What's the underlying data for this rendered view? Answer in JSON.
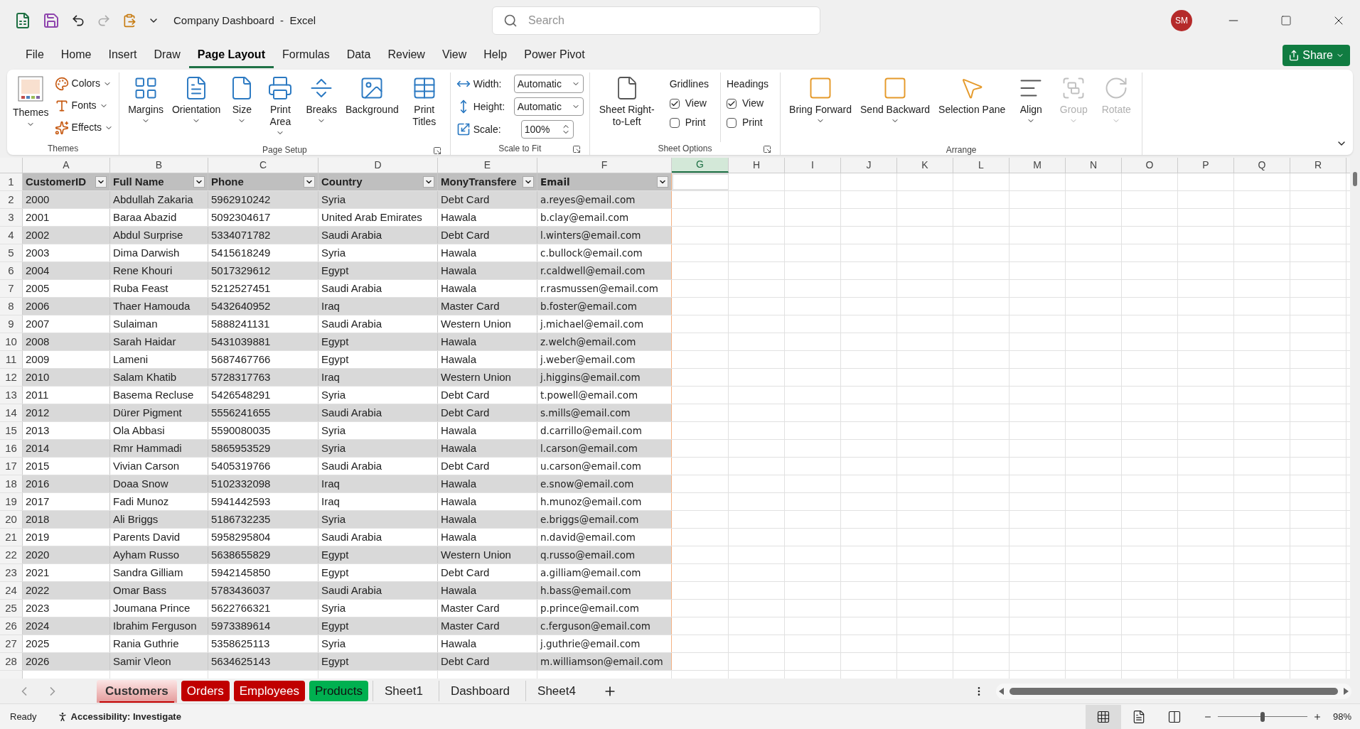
{
  "window": {
    "title": "Company Dashboard  -  Excel",
    "search": {
      "placeholder": "Search"
    },
    "avatar": "SM"
  },
  "menu_tabs": [
    {
      "label": "File",
      "selected": false
    },
    {
      "label": "Home",
      "selected": false
    },
    {
      "label": "Insert",
      "selected": false
    },
    {
      "label": "Draw",
      "selected": false
    },
    {
      "label": "Page Layout",
      "selected": true
    },
    {
      "label": "Formulas",
      "selected": false
    },
    {
      "label": "Data",
      "selected": false
    },
    {
      "label": "Review",
      "selected": false
    },
    {
      "label": "View",
      "selected": false
    },
    {
      "label": "Help",
      "selected": false
    },
    {
      "label": "Power Pivot",
      "selected": false
    }
  ],
  "share_button": "Share",
  "ribbon": {
    "themes": {
      "title": "Themes",
      "big": {
        "label": "Themes",
        "dropdown": true
      },
      "small": [
        {
          "label": "Colors",
          "dropdown": true
        },
        {
          "label": "Fonts",
          "dropdown": true
        },
        {
          "label": "Effects",
          "dropdown": true
        }
      ]
    },
    "page_setup": {
      "title": "Page Setup",
      "launcher": true,
      "buttons": [
        {
          "label": "Margins",
          "dropdown": true
        },
        {
          "label": "Orientation",
          "dropdown": true
        },
        {
          "label": "Size",
          "dropdown": true
        },
        {
          "label": "Print Area",
          "dropdown": true
        },
        {
          "label": "Breaks",
          "dropdown": true
        },
        {
          "label": "Background",
          "dropdown": false
        },
        {
          "label": "Print Titles",
          "dropdown": false
        }
      ]
    },
    "scale_to_fit": {
      "title": "Scale to Fit",
      "launcher": true,
      "fields": [
        {
          "label": "Width:",
          "value": "Automatic",
          "kind": "select"
        },
        {
          "label": "Height:",
          "value": "Automatic",
          "kind": "select"
        },
        {
          "label": "Scale:",
          "value": "100%",
          "kind": "spin"
        }
      ]
    },
    "sheet_options": {
      "title": "Sheet Options",
      "launcher": true,
      "button": {
        "label": "Sheet Right-to-Left"
      },
      "columns": [
        {
          "heading": "Gridlines",
          "options": [
            {
              "label": "View",
              "checked": true
            },
            {
              "label": "Print",
              "checked": false
            }
          ]
        },
        {
          "heading": "Headings",
          "options": [
            {
              "label": "View",
              "checked": true
            },
            {
              "label": "Print",
              "checked": false
            }
          ]
        }
      ]
    },
    "arrange": {
      "title": "Arrange",
      "buttons": [
        {
          "label": "Bring Forward",
          "dropdown": true,
          "disabled": false
        },
        {
          "label": "Send Backward",
          "dropdown": true,
          "disabled": false
        },
        {
          "label": "Selection Pane",
          "dropdown": false,
          "disabled": false
        },
        {
          "label": "Align",
          "dropdown": true,
          "disabled": false
        },
        {
          "label": "Group",
          "dropdown": true,
          "disabled": true
        },
        {
          "label": "Rotate",
          "dropdown": true,
          "disabled": true
        }
      ]
    }
  },
  "sheet": {
    "columns": [
      {
        "label": "A",
        "selected": false
      },
      {
        "label": "B",
        "selected": false
      },
      {
        "label": "C",
        "selected": false
      },
      {
        "label": "D",
        "selected": false
      },
      {
        "label": "E",
        "selected": false
      },
      {
        "label": "F",
        "selected": false
      },
      {
        "label": "G",
        "selected": true
      },
      {
        "label": "H",
        "selected": false
      },
      {
        "label": "I",
        "selected": false
      },
      {
        "label": "J",
        "selected": false
      },
      {
        "label": "K",
        "selected": false
      },
      {
        "label": "L",
        "selected": false
      },
      {
        "label": "M",
        "selected": false
      },
      {
        "label": "N",
        "selected": false
      },
      {
        "label": "O",
        "selected": false
      },
      {
        "label": "P",
        "selected": false
      },
      {
        "label": "Q",
        "selected": false
      },
      {
        "label": "R",
        "selected": false
      }
    ],
    "header": {
      "num": "1",
      "cells": [
        "CustomerID",
        "Full Name",
        "Phone",
        "Country",
        "MonyTransfere",
        "Email"
      ]
    },
    "rows": [
      {
        "num": "2",
        "cells": [
          "2000",
          "Abdullah Zakaria",
          "5962910242",
          "Syria",
          "Debt Card",
          "a.reyes@email.com"
        ]
      },
      {
        "num": "3",
        "cells": [
          "2001",
          "Baraa Abazid",
          "5092304617",
          "United Arab Emirates",
          "Hawala",
          "b.clay@email.com"
        ]
      },
      {
        "num": "4",
        "cells": [
          "2002",
          "Abdul Surprise",
          "5334071782",
          "Saudi Arabia",
          "Debt Card",
          "l.winters@email.com"
        ]
      },
      {
        "num": "5",
        "cells": [
          "2003",
          "Dima Darwish",
          "5415618249",
          "Syria",
          "Hawala",
          "c.bullock@email.com"
        ]
      },
      {
        "num": "6",
        "cells": [
          "2004",
          "Rene Khouri",
          "5017329612",
          "Egypt",
          "Hawala",
          "r.caldwell@email.com"
        ]
      },
      {
        "num": "7",
        "cells": [
          "2005",
          "Ruba Feast",
          "5212527451",
          "Saudi Arabia",
          "Hawala",
          "r.rasmussen@email.com"
        ]
      },
      {
        "num": "8",
        "cells": [
          "2006",
          "Thaer Hamouda",
          "5432640952",
          "Iraq",
          "Master Card",
          "b.foster@email.com"
        ]
      },
      {
        "num": "9",
        "cells": [
          "2007",
          "Sulaiman",
          "5888241131",
          "Saudi Arabia",
          "Western Union",
          "j.michael@email.com"
        ]
      },
      {
        "num": "10",
        "cells": [
          "2008",
          "Sarah Haidar",
          "5431039881",
          "Egypt",
          "Hawala",
          "z.welch@email.com"
        ]
      },
      {
        "num": "11",
        "cells": [
          "2009",
          "Lameni",
          "5687467766",
          "Egypt",
          "Hawala",
          "j.weber@email.com"
        ]
      },
      {
        "num": "12",
        "cells": [
          "2010",
          "Salam Khatib",
          "5728317763",
          "Iraq",
          "Western Union",
          "j.higgins@email.com"
        ]
      },
      {
        "num": "13",
        "cells": [
          "2011",
          "Basema Recluse",
          "5426548291",
          "Syria",
          "Debt Card",
          "t.powell@email.com"
        ]
      },
      {
        "num": "14",
        "cells": [
          "2012",
          "Dürer Pigment",
          "5556241655",
          "Saudi Arabia",
          "Debt Card",
          "s.mills@email.com"
        ]
      },
      {
        "num": "15",
        "cells": [
          "2013",
          "Ola Abbasi",
          "5590080035",
          "Syria",
          "Hawala",
          "d.carrillo@email.com"
        ]
      },
      {
        "num": "16",
        "cells": [
          "2014",
          "Rmr Hammadi",
          "5865953529",
          "Syria",
          "Hawala",
          "l.carson@email.com"
        ]
      },
      {
        "num": "17",
        "cells": [
          "2015",
          "Vivian Carson",
          "5405319766",
          "Saudi Arabia",
          "Debt Card",
          "u.carson@email.com"
        ]
      },
      {
        "num": "18",
        "cells": [
          "2016",
          "Doaa Snow",
          "5102332098",
          "Iraq",
          "Hawala",
          "e.snow@email.com"
        ]
      },
      {
        "num": "19",
        "cells": [
          "2017",
          "Fadi Munoz",
          "5941442593",
          "Iraq",
          "Hawala",
          "h.munoz@email.com"
        ]
      },
      {
        "num": "20",
        "cells": [
          "2018",
          "Ali Briggs",
          "5186732235",
          "Syria",
          "Hawala",
          "e.briggs@email.com"
        ]
      },
      {
        "num": "21",
        "cells": [
          "2019",
          "Parents David",
          "5958295804",
          "Saudi Arabia",
          "Hawala",
          "n.david@email.com"
        ]
      },
      {
        "num": "22",
        "cells": [
          "2020",
          "Ayham Russo",
          "5638655829",
          "Egypt",
          "Western Union",
          "q.russo@email.com"
        ]
      },
      {
        "num": "23",
        "cells": [
          "2021",
          "Sandra Gilliam",
          "5942145850",
          "Egypt",
          "Debt Card",
          "a.gilliam@email.com"
        ]
      },
      {
        "num": "24",
        "cells": [
          "2022",
          "Omar Bass",
          "5783436037",
          "Saudi Arabia",
          "Hawala",
          "h.bass@email.com"
        ]
      },
      {
        "num": "25",
        "cells": [
          "2023",
          "Joumana Prince",
          "5622766321",
          "Syria",
          "Master Card",
          "p.prince@email.com"
        ]
      },
      {
        "num": "26",
        "cells": [
          "2024",
          "Ibrahim Ferguson",
          "5973389614",
          "Egypt",
          "Master Card",
          "c.ferguson@email.com"
        ]
      },
      {
        "num": "27",
        "cells": [
          "2025",
          "Rania Guthrie",
          "5358625113",
          "Syria",
          "Hawala",
          "j.guthrie@email.com"
        ]
      },
      {
        "num": "28",
        "cells": [
          "2026",
          "Samir Vleon",
          "5634625143",
          "Egypt",
          "Debt Card",
          "m.williamson@email.com"
        ]
      }
    ]
  },
  "sheet_tabs": [
    {
      "label": "Customers",
      "selected": true,
      "color": "#c00000"
    },
    {
      "label": "Orders",
      "selected": false,
      "color": "#c00000"
    },
    {
      "label": "Employees",
      "selected": false,
      "color": "#c00000"
    },
    {
      "label": "Products",
      "selected": false,
      "color": "#00b050"
    },
    {
      "label": "Sheet1",
      "selected": false
    },
    {
      "label": "Dashboard",
      "selected": false
    },
    {
      "label": "Sheet4",
      "selected": false
    }
  ],
  "status_bar": {
    "ready": "Ready",
    "accessibility": "Accessibility: Investigate",
    "views": [
      {
        "selected": true
      },
      {
        "selected": false
      },
      {
        "selected": false
      }
    ],
    "zoom": {
      "level": 0.5,
      "reading": "98%"
    }
  }
}
